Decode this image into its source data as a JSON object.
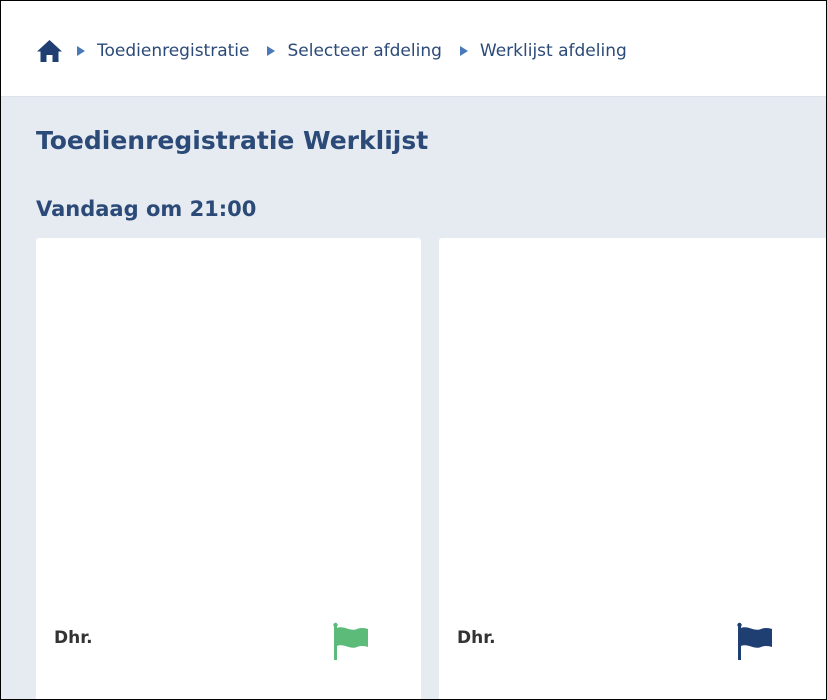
{
  "breadcrumb": {
    "items": [
      {
        "label": "Toedienregistratie"
      },
      {
        "label": "Selecteer afdeling"
      },
      {
        "label": "Werklijst afdeling"
      }
    ]
  },
  "page": {
    "title": "Toedienregistratie Werklijst",
    "section_title": "Vandaag om 21:00"
  },
  "cards": [
    {
      "salutation": "Dhr.",
      "flag_icon": "flag-icon",
      "flag_color": "#4caf6a"
    },
    {
      "salutation": "Dhr.",
      "flag_icon": "flag-icon",
      "flag_color": "#1f3f73"
    }
  ],
  "colors": {
    "accent": "#2b4a78",
    "background": "#e6ebf1",
    "card": "#ffffff"
  }
}
